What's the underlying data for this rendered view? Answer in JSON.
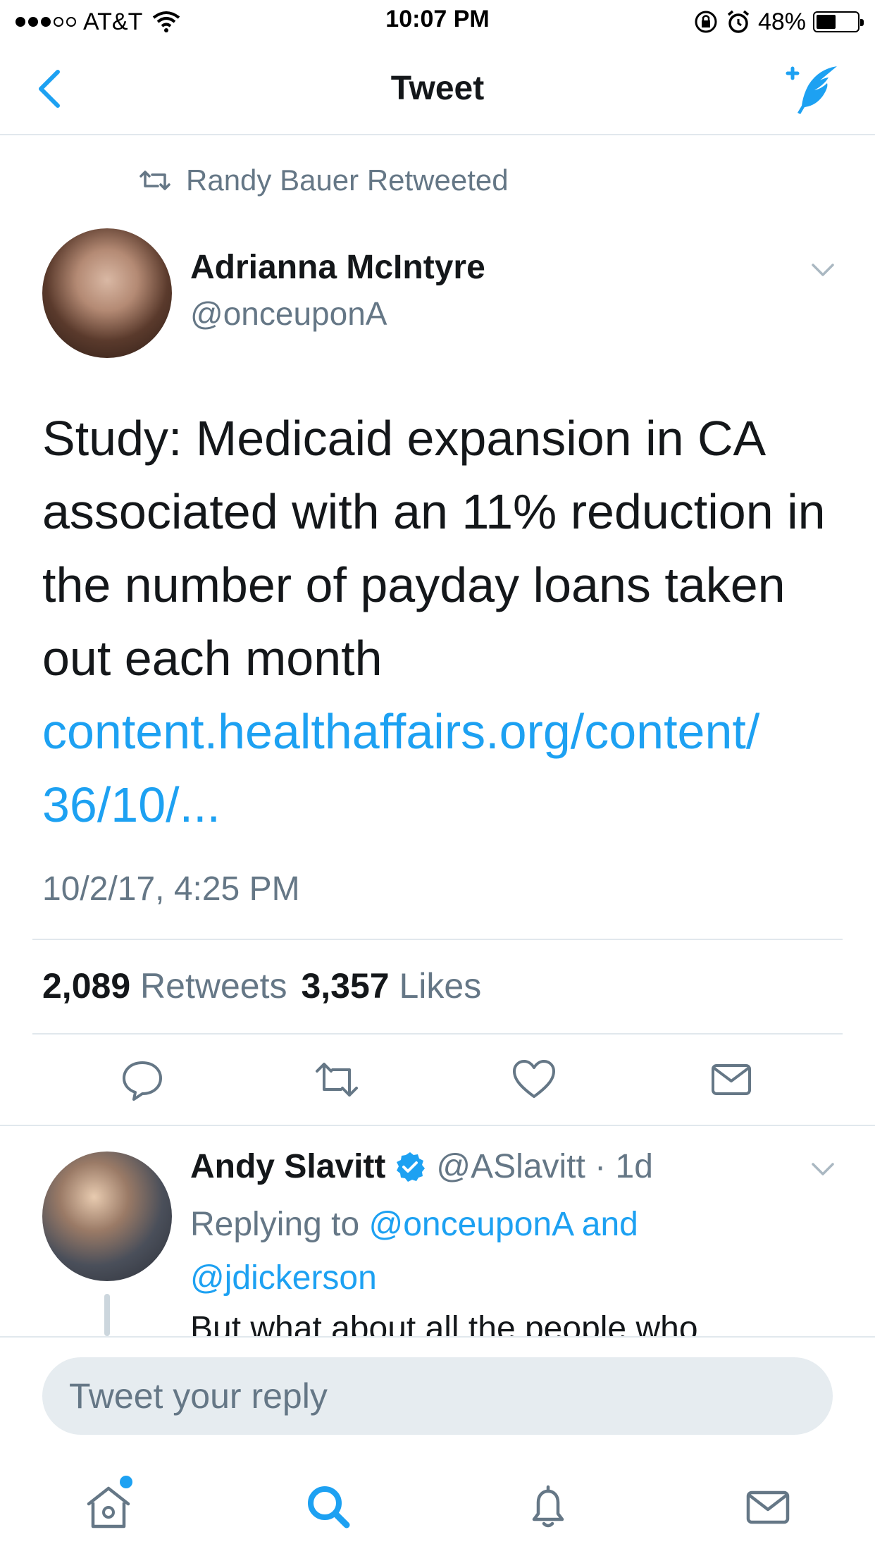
{
  "status_bar": {
    "carrier": "AT&T",
    "time": "10:07 PM",
    "battery": "48%",
    "battery_level": 0.48
  },
  "nav": {
    "title": "Tweet"
  },
  "retweet": {
    "label": "Randy Bauer Retweeted"
  },
  "tweet": {
    "author_name": "Adrianna McIntyre",
    "author_handle": "@onceuponA",
    "text": "Study: Medicaid expansion in CA associated with an 11% reduction in the number of payday loans taken out each month",
    "link_line1": "content.healthaffairs.org/content/",
    "link_line2": "36/10/...",
    "timestamp": "10/2/17, 4:25 PM",
    "retweets_count": "2,089",
    "retweets_label": "Retweets",
    "likes_count": "3,357",
    "likes_label": "Likes"
  },
  "reply": {
    "author_name": "Andy Slavitt",
    "handle_time": "@ASlavitt · 1d",
    "replying_to_prefix": "Replying to ",
    "mention1": "@onceuponA",
    "and": " and",
    "mention2": "@jdickerson",
    "text": "But what about all the people who"
  },
  "reply_bar": {
    "placeholder": "Tweet your reply"
  },
  "colors": {
    "accent": "#1da1f2",
    "text_primary": "#14171a",
    "text_secondary": "#657786",
    "divider": "#e1e8ed"
  },
  "icons": {
    "back": "chevron-left-icon",
    "compose": "compose-tweet-icon",
    "retweet": "retweet-icon",
    "caret": "chevron-down-icon",
    "reply": "reply-icon",
    "like": "heart-icon",
    "dm": "envelope-icon",
    "verified": "verified-badge-icon",
    "home": "home-icon",
    "search": "search-icon",
    "notifications": "bell-icon",
    "messages": "envelope-icon"
  }
}
